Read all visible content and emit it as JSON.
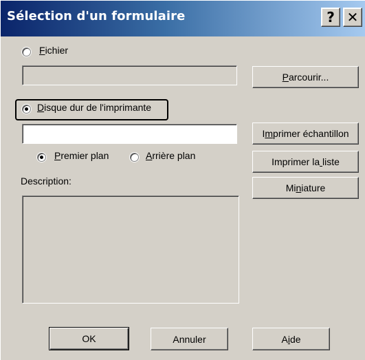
{
  "dialog": {
    "title": "Sélection d'un formulaire",
    "help_icon": "help-icon",
    "close_icon": "close-icon"
  },
  "source": {
    "file_option": {
      "label": "Fichier",
      "mnemonic": "F",
      "selected": false
    },
    "file_path_value": "",
    "browse_button": "Parcourir...",
    "disk_option": {
      "label": "Disque dur de l'imprimante",
      "mnemonic": "D",
      "selected": true
    },
    "disk_name_value": ""
  },
  "layer": {
    "foreground": {
      "label": "Premier plan",
      "mnemonic": "P",
      "selected": true
    },
    "background": {
      "label": "Arrière plan",
      "mnemonic": "A",
      "selected": false
    }
  },
  "description": {
    "label": "Description:",
    "value": ""
  },
  "side_buttons": {
    "print_sample": "Imprimer échantillon",
    "print_list": "Imprimer la liste",
    "thumbnail": "Miniature"
  },
  "footer": {
    "ok": "OK",
    "cancel": "Annuler",
    "help": "Aide"
  },
  "colors": {
    "title_gradient_start": "#0a246a",
    "title_gradient_end": "#a6caf0",
    "face": "#d4d0c8"
  }
}
